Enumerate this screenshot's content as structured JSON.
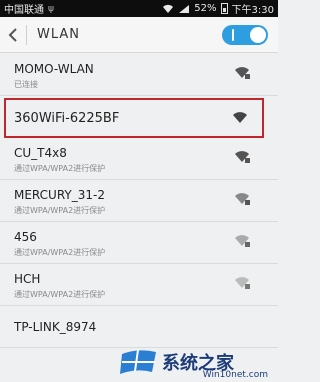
{
  "statusbar": {
    "carrier": "中国联通",
    "usb": "ψ",
    "battery": "52%",
    "time": "下午3:30"
  },
  "header": {
    "back_icon": "chevron-left-icon",
    "title": "WLAN",
    "toggle_on": true
  },
  "networks": [
    {
      "name": "MOMO-WLAN",
      "status": "已连接"
    },
    {
      "name": "360WiFi-6225BF",
      "status": ""
    },
    {
      "name": "CU_T4x8",
      "status": "通过WPA/WPA2进行保护"
    },
    {
      "name": "MERCURY_31-2",
      "status": "通过WPA/WPA2进行保护"
    },
    {
      "name": "456",
      "status": "通过WPA/WPA2进行保护"
    },
    {
      "name": "HCH",
      "status": "通过WPA/WPA2进行保护"
    },
    {
      "name": "TP-LINK_8974",
      "status": ""
    }
  ],
  "watermark": {
    "text": "系统之家",
    "url": "Win10net.com"
  },
  "colors": {
    "accent": "#2f9ee0",
    "highlight": "#c0272d"
  }
}
